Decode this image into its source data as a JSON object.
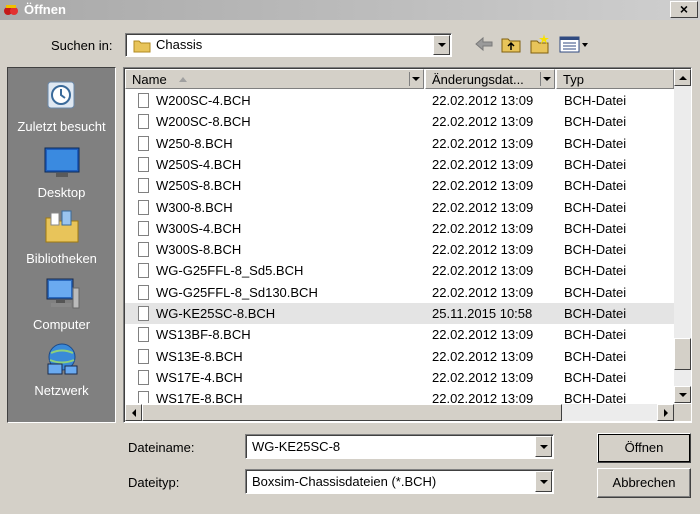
{
  "window": {
    "title": "Öffnen",
    "close": "×"
  },
  "toolbar": {
    "look_in_label": "Suchen in:",
    "look_in_value": "Chassis"
  },
  "places": [
    {
      "label": "Zuletzt besucht",
      "icon": "recent-places-icon"
    },
    {
      "label": "Desktop",
      "icon": "desktop-icon"
    },
    {
      "label": "Bibliotheken",
      "icon": "libraries-icon"
    },
    {
      "label": "Computer",
      "icon": "computer-icon"
    },
    {
      "label": "Netzwerk",
      "icon": "network-icon"
    }
  ],
  "columns": [
    {
      "label": "Name"
    },
    {
      "label": "Änderungsdat..."
    },
    {
      "label": "Typ"
    }
  ],
  "files": [
    {
      "name": "W200SC-4.BCH",
      "date": "22.02.2012 13:09",
      "type": "BCH-Datei"
    },
    {
      "name": "W200SC-8.BCH",
      "date": "22.02.2012 13:09",
      "type": "BCH-Datei"
    },
    {
      "name": "W250-8.BCH",
      "date": "22.02.2012 13:09",
      "type": "BCH-Datei"
    },
    {
      "name": "W250S-4.BCH",
      "date": "22.02.2012 13:09",
      "type": "BCH-Datei"
    },
    {
      "name": "W250S-8.BCH",
      "date": "22.02.2012 13:09",
      "type": "BCH-Datei"
    },
    {
      "name": "W300-8.BCH",
      "date": "22.02.2012 13:09",
      "type": "BCH-Datei"
    },
    {
      "name": "W300S-4.BCH",
      "date": "22.02.2012 13:09",
      "type": "BCH-Datei"
    },
    {
      "name": "W300S-8.BCH",
      "date": "22.02.2012 13:09",
      "type": "BCH-Datei"
    },
    {
      "name": "WG-G25FFL-8_Sd5.BCH",
      "date": "22.02.2012 13:09",
      "type": "BCH-Datei"
    },
    {
      "name": "WG-G25FFL-8_Sd130.BCH",
      "date": "22.02.2012 13:09",
      "type": "BCH-Datei"
    },
    {
      "name": "WG-KE25SC-8.BCH",
      "date": "25.11.2015 10:58",
      "type": "BCH-Datei",
      "selected": true
    },
    {
      "name": "WS13BF-8.BCH",
      "date": "22.02.2012 13:09",
      "type": "BCH-Datei"
    },
    {
      "name": "WS13E-8.BCH",
      "date": "22.02.2012 13:09",
      "type": "BCH-Datei"
    },
    {
      "name": "WS17E-4.BCH",
      "date": "22.02.2012 13:09",
      "type": "BCH-Datei"
    },
    {
      "name": "WS17E-8.BCH",
      "date": "22.02.2012 13:09",
      "type": "BCH-Datei"
    }
  ],
  "filename": {
    "label": "Dateiname:",
    "value": "WG-KE25SC-8"
  },
  "filetype": {
    "label": "Dateityp:",
    "value": "Boxsim-Chassisdateien (*.BCH)"
  },
  "buttons": {
    "open": "Öffnen",
    "cancel": "Abbrechen"
  }
}
